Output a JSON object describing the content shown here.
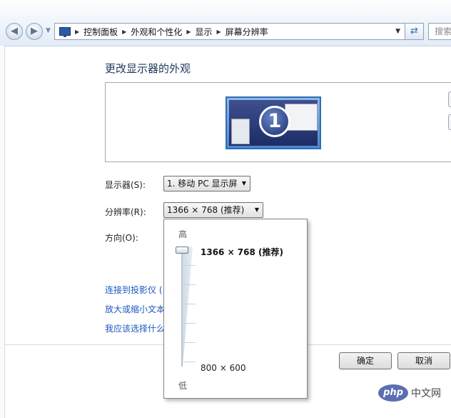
{
  "address_bar": {
    "breadcrumbs": [
      "控制面板",
      "外观和个性化",
      "显示",
      "屏幕分辨率"
    ],
    "search_placeholder": "搜索"
  },
  "main": {
    "title": "更改显示器的外观",
    "monitor_number": "1",
    "display_label": "显示器(S):",
    "display_value": "1. 移动 PC 显示屏",
    "resolution_label": "分辨率(R):",
    "resolution_value": "1366 × 768 (推荐)",
    "orientation_label": "方向(O):",
    "links": [
      "连接到投影仪 (",
      "放大或缩小文本",
      "我应该选择什么"
    ]
  },
  "resolution_dropdown": {
    "high_label": "高",
    "low_label": "低",
    "top_resolution": "1366 × 768 (推荐)",
    "bottom_resolution": "800 × 600",
    "slider_level": 1.0
  },
  "buttons": {
    "ok": "确定",
    "cancel": "取消"
  },
  "watermark": {
    "logo_text": "php",
    "site_text": "中文网"
  },
  "colors": {
    "title": "#1e395b",
    "link": "#1c57c2",
    "monitor_accent": "#2e6cb8"
  }
}
